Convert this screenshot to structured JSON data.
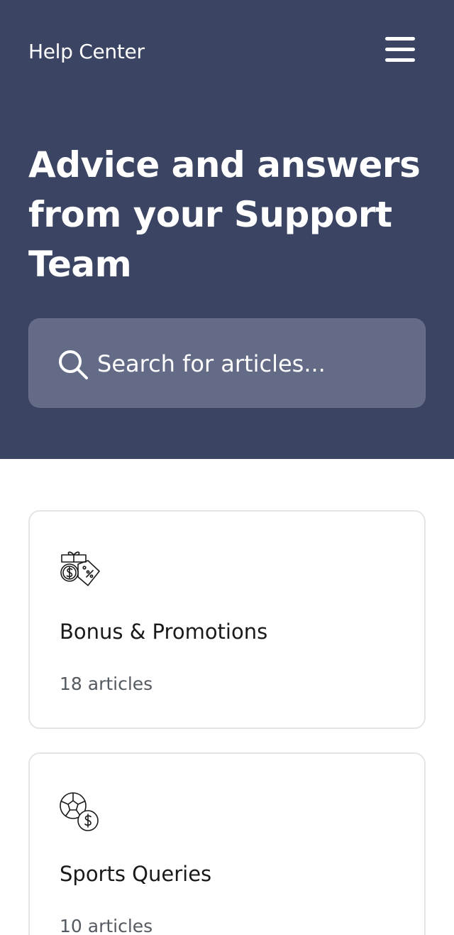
{
  "header": {
    "brand": "Help Center",
    "menu_icon": "hamburger-menu-icon"
  },
  "hero": {
    "title": "Advice and answers from your Support Team"
  },
  "search": {
    "icon": "search-icon",
    "placeholder": "Search for articles..."
  },
  "collections": [
    {
      "icon": "bonus-promotions-icon",
      "title": "Bonus & Promotions",
      "count": "18 articles"
    },
    {
      "icon": "sports-betting-icon",
      "title": "Sports Queries",
      "count": "10 articles"
    }
  ],
  "colors": {
    "hero_background": "#3b4462",
    "search_background": "#646b86",
    "card_border": "#e5e5e8",
    "text_primary": "#1a1a1a",
    "text_secondary": "#555a61"
  }
}
